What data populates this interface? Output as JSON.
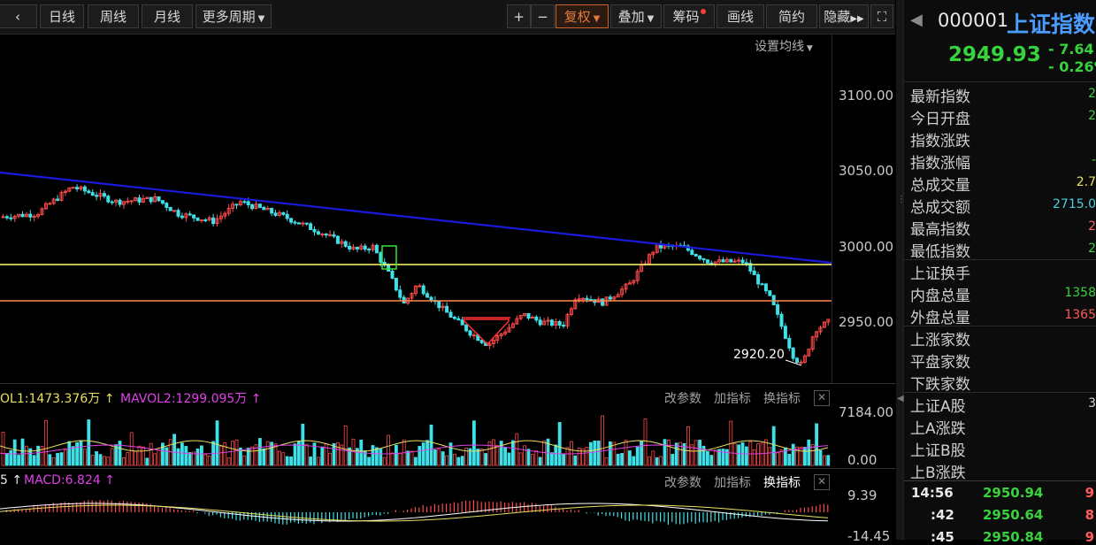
{
  "toolbar": {
    "periods": [
      "日线",
      "周线",
      "月线",
      "更多周期"
    ],
    "zoom_in": "+",
    "zoom_out": "−",
    "tools": [
      "复权",
      "叠加",
      "筹码",
      "画线",
      "简约",
      "隐藏"
    ],
    "ma_settings": "设置均线"
  },
  "price_axis": [
    "3100.00",
    "3050.00",
    "3000.00",
    "2950.00"
  ],
  "low_annotation": "2920.20",
  "volume_pane": {
    "indicator_prefix": "OL1:1473.376万",
    "mavol2": "MAVOL2:1299.095万",
    "axis_top": "7184.00",
    "axis_bottom": "0.00",
    "btn_params": "改参数",
    "btn_add": "加指标",
    "btn_switch": "换指标"
  },
  "macd_pane": {
    "indicator_prefix": "5",
    "macd": "MACD:6.824",
    "axis_top": "9.39",
    "axis_bottom": "-14.45",
    "btn_params": "改参数",
    "btn_add": "加指标",
    "btn_switch": "换指标"
  },
  "quote": {
    "code": "000001",
    "name": "上证指数",
    "price": "2949.93",
    "change": "- 7.64",
    "change_pct": "- 0.26%",
    "rows": [
      {
        "label": "最新指数",
        "value": "2"
      },
      {
        "label": "今日开盘",
        "value": "2"
      },
      {
        "label": "指数涨跌",
        "value": ""
      },
      {
        "label": "指数涨幅",
        "value": "-"
      },
      {
        "label": "总成交量",
        "value": "2.7"
      },
      {
        "label": "总成交额",
        "value": "2715.0"
      },
      {
        "label": "最高指数",
        "value": "2"
      },
      {
        "label": "最低指数",
        "value": "2"
      },
      {
        "label": "上证换手",
        "value": ""
      },
      {
        "label": "内盘总量",
        "value": "1358"
      },
      {
        "label": "外盘总量",
        "value": "1365"
      },
      {
        "label": "上涨家数",
        "value": ""
      },
      {
        "label": "平盘家数",
        "value": ""
      },
      {
        "label": "下跌家数",
        "value": ""
      },
      {
        "label": "上证A股",
        "value": "3"
      },
      {
        "label": "上A涨跌",
        "value": ""
      },
      {
        "label": "上证B股",
        "value": ""
      },
      {
        "label": "上B涨跌",
        "value": ""
      }
    ],
    "ticks": [
      {
        "time": "14:56",
        "price": "2950.94",
        "vol": "9"
      },
      {
        "time": ":42",
        "price": "2950.64",
        "vol": "8"
      },
      {
        "time": ":45",
        "price": "2950.84",
        "vol": "9"
      }
    ]
  },
  "colors": {
    "up": "#ff4a4a",
    "down": "#3fe0e8",
    "trendline": "#1a1adc",
    "support_yellow": "#ffff6e",
    "support_orange": "#ff8a50",
    "quote_green": "#37d23c"
  }
}
